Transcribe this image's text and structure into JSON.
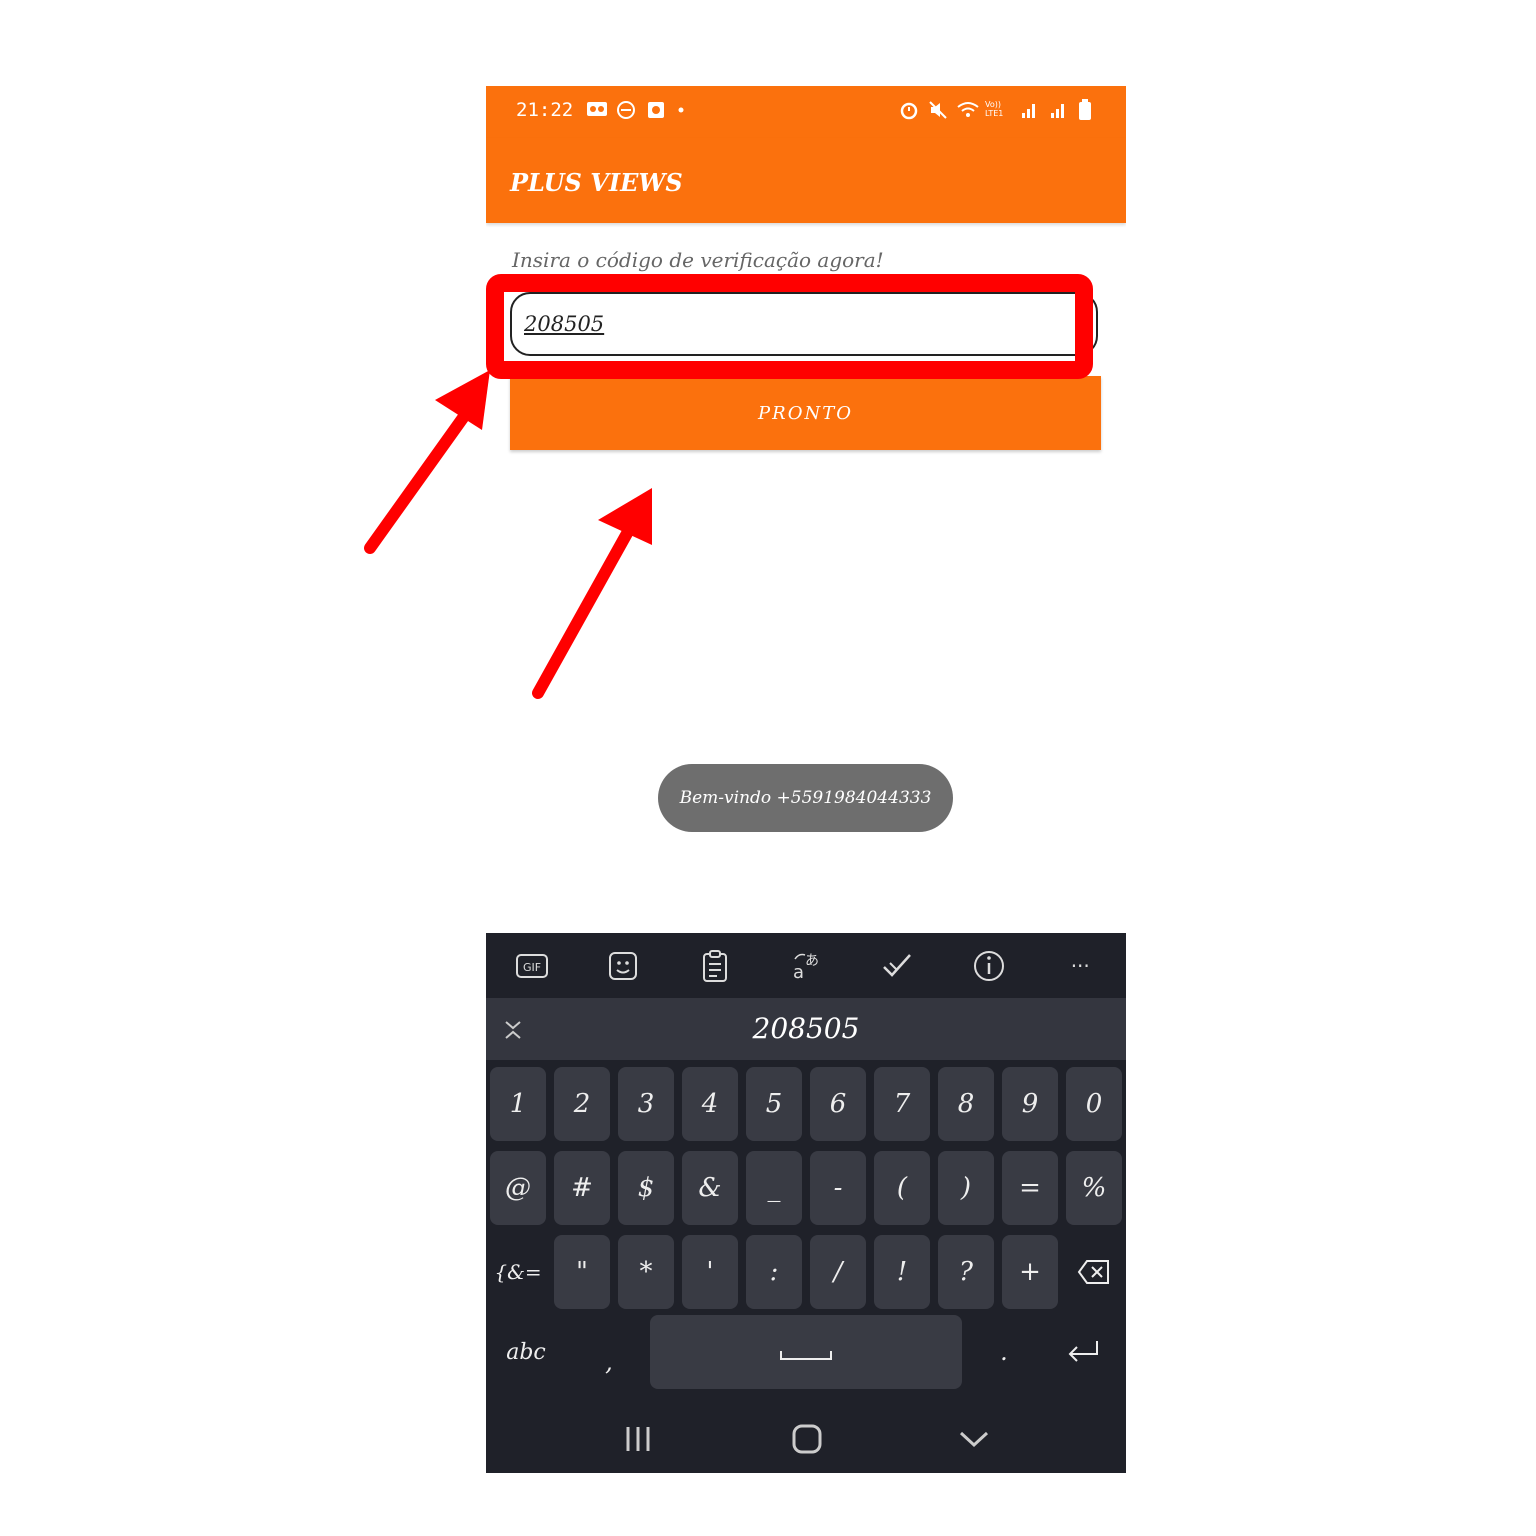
{
  "status_bar": {
    "time": "21:22",
    "network": "Vo)) LTE1"
  },
  "app_bar": {
    "title": "PLUS VIEWS"
  },
  "verification": {
    "prompt": "Insira o código de verificação agora!",
    "code_value": "208505",
    "done_label": "PRONTO"
  },
  "toast": {
    "message": "Bem-vindo +5591984044333"
  },
  "keyboard": {
    "suggestion": "208505",
    "toolbar": [
      "gif-icon",
      "sticker-icon",
      "clipboard-icon",
      "translate-icon",
      "spellcheck-icon",
      "info-icon",
      "more-icon"
    ],
    "gif_label": "GIF",
    "more_label": "···",
    "row1": [
      "1",
      "2",
      "3",
      "4",
      "5",
      "6",
      "7",
      "8",
      "9",
      "0"
    ],
    "row2": [
      "@",
      "#",
      "$",
      "&",
      "_",
      "-",
      "(",
      ")",
      "=",
      "%"
    ],
    "row3": [
      "\"",
      "*",
      "'",
      ":",
      "/",
      "!",
      "?",
      "+"
    ],
    "symbols_label": "{&=",
    "abc_label": "abc",
    "comma": ",",
    "period": "."
  },
  "colors": {
    "brand": "#fb710d",
    "annotation": "#ff0000",
    "keyboard_bg": "#1f2129",
    "key_bg": "#393b44"
  }
}
